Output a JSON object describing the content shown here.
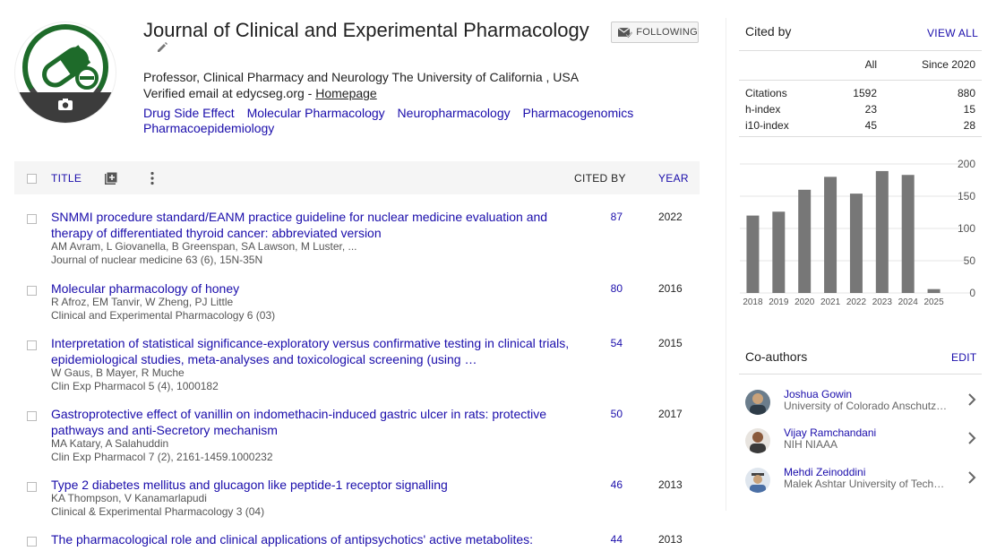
{
  "profile": {
    "name": "Journal of Clinical and Experimental Pharmacology",
    "affiliation": "Professor, Clinical Pharmacy and Neurology The University of California , USA",
    "verified_prefix": "Verified email at edycseg.org - ",
    "homepage_label": "Homepage",
    "interests": [
      "Drug Side Effect",
      "Molecular Pharmacology",
      "Neuropharmacology",
      "Pharmacogenomics",
      "Pharmacoepidemiology"
    ],
    "follow_label": "FOLLOWING"
  },
  "table": {
    "title_header": "TITLE",
    "cited_by_header": "CITED BY",
    "year_header": "YEAR",
    "articles": [
      {
        "title": "SNMMI procedure standard/EANM practice guideline for nuclear medicine evaluation and therapy of differentiated thyroid cancer: abbreviated version",
        "authors": "AM Avram, L Giovanella, B Greenspan, SA Lawson, M Luster, ...",
        "venue": "Journal of nuclear medicine 63 (6), 15N-35N",
        "cited_by": "87",
        "year": "2022"
      },
      {
        "title": "Molecular pharmacology of honey",
        "authors": "R Afroz, EM Tanvir, W Zheng, PJ Little",
        "venue": "Clinical and Experimental Pharmacology 6 (03)",
        "cited_by": "80",
        "year": "2016"
      },
      {
        "title": "Interpretation of statistical significance-exploratory versus confirmative testing in clinical trials, epidemiological studies, meta-analyses and toxicological screening (using …",
        "authors": "W Gaus, B Mayer, R Muche",
        "venue": "Clin Exp Pharmacol 5 (4), 1000182",
        "cited_by": "54",
        "year": "2015"
      },
      {
        "title": "Gastroprotective effect of vanillin on indomethacin-induced gastric ulcer in rats: protective pathways and anti-Secretory mechanism",
        "authors": "MA Katary, A Salahuddin",
        "venue": "Clin Exp Pharmacol 7 (2), 2161-1459.1000232",
        "cited_by": "50",
        "year": "2017"
      },
      {
        "title": "Type 2 diabetes mellitus and glucagon like peptide-1 receptor signalling",
        "authors": "KA Thompson, V Kanamarlapudi",
        "venue": "Clinical & Experimental Pharmacology 3 (04)",
        "cited_by": "46",
        "year": "2013"
      },
      {
        "title": "The pharmacological role and clinical applications of antipsychotics' active metabolites:",
        "authors": "",
        "venue": "",
        "cited_by": "44",
        "year": "2013"
      }
    ]
  },
  "cited_by": {
    "heading": "Cited by",
    "view_all": "VIEW ALL",
    "col_all": "All",
    "col_since": "Since 2020",
    "rows": [
      {
        "label": "Citations",
        "all": "1592",
        "since": "880"
      },
      {
        "label": "h-index",
        "all": "23",
        "since": "15"
      },
      {
        "label": "i10-index",
        "all": "45",
        "since": "28"
      }
    ]
  },
  "chart_data": {
    "type": "bar",
    "categories": [
      "2018",
      "2019",
      "2020",
      "2021",
      "2022",
      "2023",
      "2024",
      "2025"
    ],
    "values": [
      120,
      126,
      160,
      180,
      154,
      189,
      183,
      6
    ],
    "yticks": [
      "200",
      "150",
      "100",
      "50",
      "0"
    ],
    "ylim": [
      0,
      200
    ],
    "bar_color": "#777777",
    "title": "",
    "xlabel": "",
    "ylabel": ""
  },
  "coauthors": {
    "heading": "Co-authors",
    "edit": "EDIT",
    "people": [
      {
        "name": "Joshua Gowin",
        "affiliation": "University of Colorado Anschutz Medical Campus"
      },
      {
        "name": "Vijay Ramchandani",
        "affiliation": "NIH NIAAA"
      },
      {
        "name": "Mehdi Zeinoddini",
        "affiliation": "Malek Ashtar University of Technology"
      }
    ]
  },
  "colors": {
    "link": "#1a0dab",
    "header_bg": "#f5f5f5"
  }
}
